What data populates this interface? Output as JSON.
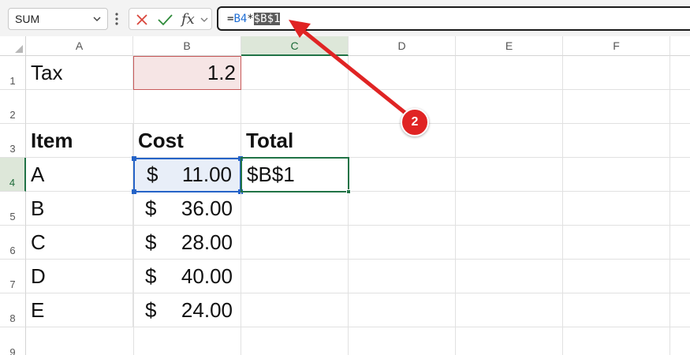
{
  "formula_bar": {
    "name_box": "SUM",
    "fx_label": "fx",
    "formula_part1": "=",
    "formula_ref": "B4",
    "formula_op": "*",
    "formula_selected": "$B$1"
  },
  "columns": [
    "A",
    "B",
    "C",
    "D",
    "E",
    "F"
  ],
  "rows": [
    "1",
    "2",
    "3",
    "4",
    "5",
    "6",
    "7",
    "8",
    "9"
  ],
  "cells": {
    "A1": "Tax",
    "B1": "1.2",
    "A3": "Item",
    "B3": "Cost",
    "C3": "Total",
    "A4": "A",
    "C4": "$B$1",
    "A5": "B",
    "A6": "C",
    "A7": "D",
    "A8": "E"
  },
  "costs": [
    {
      "symbol": "$",
      "amount": "11.00"
    },
    {
      "symbol": "$",
      "amount": "36.00"
    },
    {
      "symbol": "$",
      "amount": "28.00"
    },
    {
      "symbol": "$",
      "amount": "40.00"
    },
    {
      "symbol": "$",
      "amount": "24.00"
    }
  ],
  "annotation": {
    "badge_number": "2"
  },
  "colors": {
    "excel_green": "#217346",
    "reference_blue": "#2563c7",
    "tax_cell_red": "#c85a5a",
    "annotation_red": "#e02424"
  }
}
